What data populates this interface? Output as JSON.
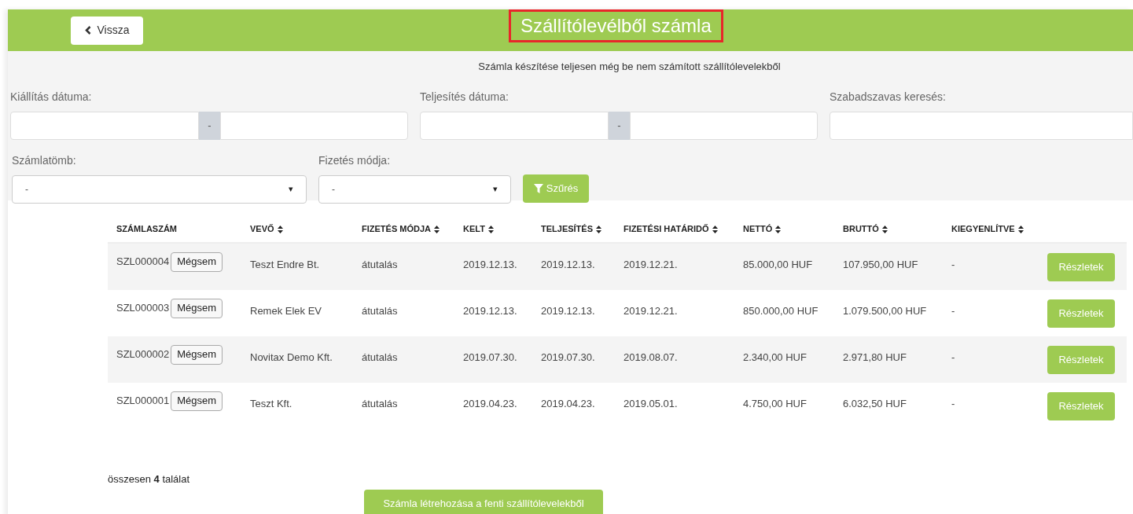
{
  "header": {
    "back_button": "Vissza",
    "title": "Szállítólevélből számla"
  },
  "subtitle": "Számla készítése teljesen még be nem számított szállítólevelekből",
  "filters": {
    "issue_date": {
      "label": "Kiállítás dátuma:",
      "separator": "-"
    },
    "completion_date": {
      "label": "Teljesítés dátuma:",
      "separator": "-"
    },
    "search": {
      "label": "Szabadszavas keresés:"
    },
    "invoice_block": {
      "label": "Számlatömb:",
      "value": "-",
      "arrow": "▾"
    },
    "payment_method": {
      "label": "Fizetés módja:",
      "value": "-",
      "arrow": "▾"
    },
    "filter_button": "Szűrés"
  },
  "table": {
    "columns": [
      {
        "label": "SZÁMLASZÁM",
        "sortable": false
      },
      {
        "label": "VEVŐ",
        "sortable": true
      },
      {
        "label": "FIZETÉS MÓDJA",
        "sortable": true
      },
      {
        "label": "KELT",
        "sortable": true
      },
      {
        "label": "TELJESÍTÉS",
        "sortable": true
      },
      {
        "label": "FIZETÉSI HATÁRIDŐ",
        "sortable": true
      },
      {
        "label": "NETTÓ",
        "sortable": true
      },
      {
        "label": "BRUTTÓ",
        "sortable": true
      },
      {
        "label": "KIEGYENLÍTVE",
        "sortable": true
      }
    ],
    "rows": [
      {
        "cancel": "Mégsem",
        "cells": [
          "SZL000004",
          "Teszt Endre Bt.",
          "átutalás",
          "2019.12.13.",
          "2019.12.13.",
          "2019.12.21.",
          "85.000,00 HUF",
          "107.950,00 HUF",
          "-"
        ],
        "details": "Részletek"
      },
      {
        "cancel": "Mégsem",
        "cells": [
          "SZL000003",
          "Remek Elek EV",
          "átutalás",
          "2019.12.13.",
          "2019.12.13.",
          "2019.12.21.",
          "850.000,00 HUF",
          "1.079.500,00 HUF",
          "-"
        ],
        "details": "Részletek"
      },
      {
        "cancel": "Mégsem",
        "cells": [
          "SZL000002",
          "Novitax Demo Kft.",
          "átutalás",
          "2019.07.30.",
          "2019.07.30.",
          "2019.08.07.",
          "2.340,00 HUF",
          "2.971,80 HUF",
          "-"
        ],
        "details": "Részletek"
      },
      {
        "cancel": "Mégsem",
        "cells": [
          "SZL000001",
          "Teszt Kft.",
          "átutalás",
          "2019.04.23.",
          "2019.04.23.",
          "2019.05.01.",
          "4.750,00 HUF",
          "6.032,50 HUF",
          "-"
        ],
        "details": "Részletek"
      }
    ]
  },
  "summary": "összesen **4** találat",
  "create_button": "Számla létrehozása a fenti szállítólevelekből"
}
